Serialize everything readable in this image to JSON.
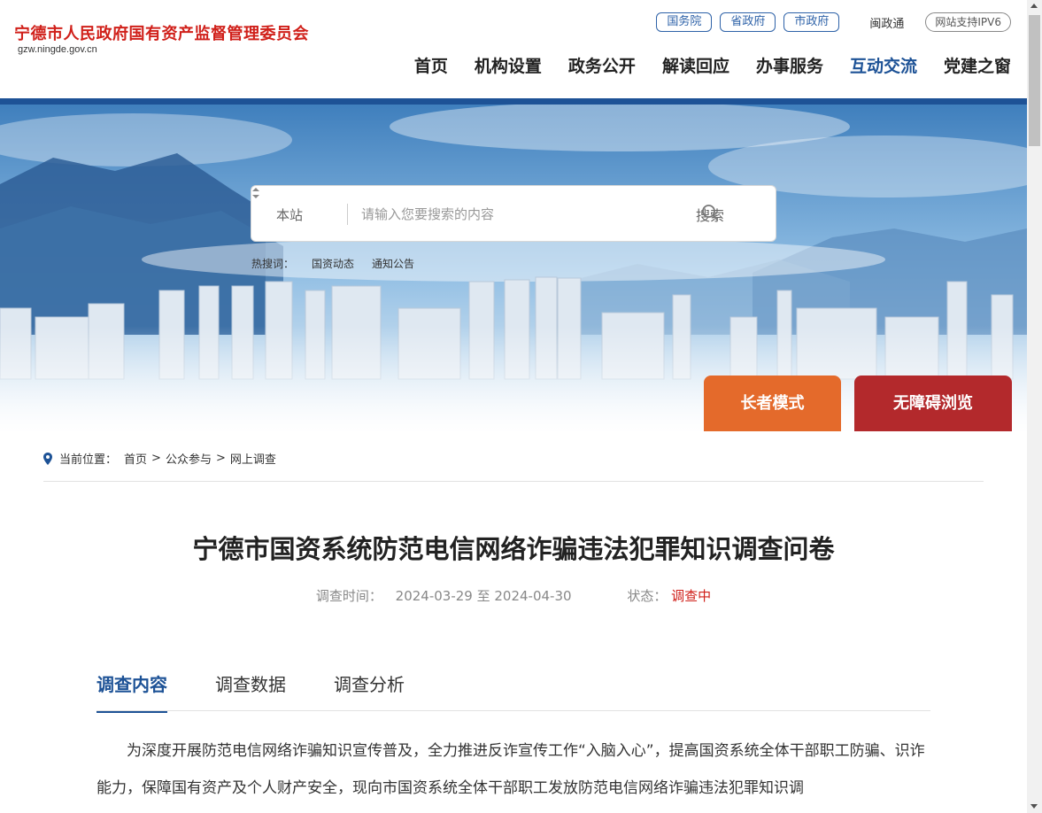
{
  "header": {
    "logo_title": "宁德市人民政府国有资产监督管理委员会",
    "logo_domain": "gzw.ningde.gov.cn",
    "top_links": [
      "国务院",
      "省政府",
      "市政府"
    ],
    "minzhengtong": "闽政通",
    "ipv6": "网站支持IPV6",
    "nav": [
      "首页",
      "机构设置",
      "政务公开",
      "解读回应",
      "办事服务",
      "互动交流",
      "党建之窗"
    ],
    "nav_active": "互动交流"
  },
  "search": {
    "scope": "本站",
    "placeholder": "请输入您要搜索的内容",
    "button": "搜索",
    "hot_label": "热搜词：",
    "hot_words": [
      "国资动态",
      "通知公告"
    ]
  },
  "modes": {
    "elder": "长者模式",
    "accessible": "无障碍浏览"
  },
  "breadcrumb": {
    "label": "当前位置：",
    "items": [
      "首页",
      "公众参与",
      "网上调查"
    ],
    "separator": ">"
  },
  "survey": {
    "title": "宁德市国资系统防范电信网络诈骗违法犯罪知识调查问卷",
    "time_label": "调查时间：",
    "time_value": "2024-03-29 至 2024-04-30",
    "status_label": "状态：",
    "status_value": "调查中"
  },
  "tabs": [
    "调查内容",
    "调查数据",
    "调查分析"
  ],
  "intro_text": "为深度开展防范电信网络诈骗知识宣传普及，全力推进反诈宣传工作“入脑入心”，提高国资系统全体干部职工防骗、识诈能力，保障国有资产及个人财产安全，现向市国资系统全体干部职工发放防范电信网络诈骗违法犯罪知识调",
  "colors": {
    "brand_blue": "#1d5296",
    "brand_red": "#d0201a",
    "elder_orange": "#e46a2b",
    "access_red": "#b3292c"
  }
}
